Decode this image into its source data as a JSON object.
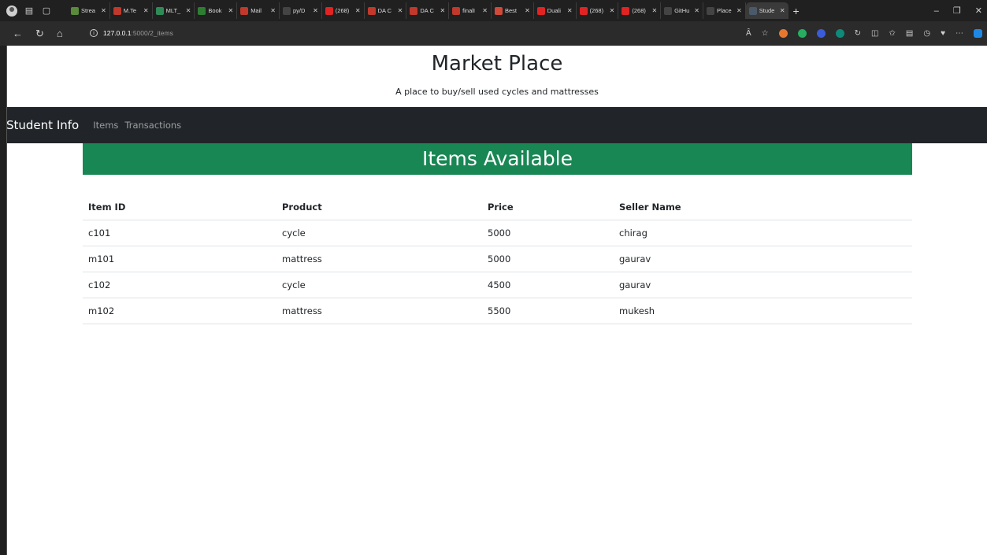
{
  "browser": {
    "tabs": [
      {
        "label": "Strea",
        "color": "#5a8a3a"
      },
      {
        "label": "M.Te",
        "color": "#c0392b"
      },
      {
        "label": "MLT_",
        "color": "#2e8b57"
      },
      {
        "label": "Book",
        "color": "#2e7d32"
      },
      {
        "label": "Mail",
        "color": "#c0392b"
      },
      {
        "label": "py/D",
        "color": "#444444"
      },
      {
        "label": "(268)",
        "color": "#e02424"
      },
      {
        "label": "DA C",
        "color": "#c0392b"
      },
      {
        "label": "DA C",
        "color": "#c0392b"
      },
      {
        "label": "finalI",
        "color": "#c0392b"
      },
      {
        "label": "Best",
        "color": "#d04a3a"
      },
      {
        "label": "Duali",
        "color": "#e02424"
      },
      {
        "label": "(268)",
        "color": "#e02424"
      },
      {
        "label": "(268)",
        "color": "#e02424"
      },
      {
        "label": "GitHu",
        "color": "#444444"
      },
      {
        "label": "Place",
        "color": "#444444"
      },
      {
        "label": "Stude",
        "color": "#4a5a6a",
        "active": true
      }
    ],
    "url_host": "127.0.0.1",
    "url_path": ":5000/2_items"
  },
  "site": {
    "title": "Market Place",
    "subtitle": "A place to buy/sell used cycles and mattresses"
  },
  "navbar": {
    "brand": "Student Info",
    "links": [
      "Items",
      "Transactions"
    ]
  },
  "page": {
    "heading": "Items Available",
    "heading_color": "#198754"
  },
  "table": {
    "columns": [
      "Item ID",
      "Product",
      "Price",
      "Seller Name"
    ],
    "rows": [
      [
        "c101",
        "cycle",
        "5000",
        "chirag"
      ],
      [
        "m101",
        "mattress",
        "5000",
        "gaurav"
      ],
      [
        "c102",
        "cycle",
        "4500",
        "gaurav"
      ],
      [
        "m102",
        "mattress",
        "5500",
        "mukesh"
      ]
    ]
  }
}
